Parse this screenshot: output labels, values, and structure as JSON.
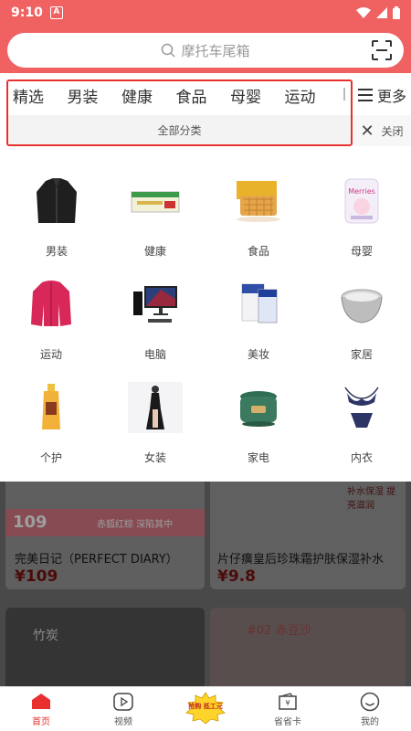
{
  "status_bar": {
    "time": "9:10",
    "notif_letter": "A"
  },
  "search": {
    "placeholder": "摩托车尾箱"
  },
  "tabs": [
    "精选",
    "男装",
    "健康",
    "食品",
    "母婴",
    "运动"
  ],
  "more_label": "更多",
  "all_categories_label": "全部分类",
  "close_label": "关闭",
  "categories": [
    {
      "label": "男装",
      "icon": "jacket-icon"
    },
    {
      "label": "健康",
      "icon": "medicine-box-icon"
    },
    {
      "label": "食品",
      "icon": "waffle-icon"
    },
    {
      "label": "母婴",
      "icon": "diaper-pack-icon"
    },
    {
      "label": "运动",
      "icon": "sport-jacket-icon"
    },
    {
      "label": "电脑",
      "icon": "desktop-computer-icon"
    },
    {
      "label": "美妆",
      "icon": "skincare-box-icon"
    },
    {
      "label": "家居",
      "icon": "steel-bowl-icon"
    },
    {
      "label": "个护",
      "icon": "shampoo-bottle-icon"
    },
    {
      "label": "女装",
      "icon": "dress-icon"
    },
    {
      "label": "家电",
      "icon": "rice-cooker-icon"
    },
    {
      "label": "内衣",
      "icon": "lingerie-icon"
    }
  ],
  "products": [
    {
      "title": "完美日记（PERFECT DIARY）",
      "price": "¥109",
      "badge_price": "109",
      "banner_text": "赤狐红棕 深陷其中"
    },
    {
      "title": "片仔癀皇后珍珠霜护肤保湿补水",
      "price": "¥9.8",
      "banner_text": "补水保湿 提亮滋润"
    }
  ],
  "lower_cards": [
    {
      "overlay_text": "竹炭"
    },
    {
      "overlay_text": "#02 赤豆沙"
    }
  ],
  "bottom_nav": [
    {
      "label": "首页",
      "icon": "home-icon",
      "active": true
    },
    {
      "label": "视频",
      "icon": "video-play-icon"
    },
    {
      "label": "",
      "icon": "promo-badge-icon",
      "promo_text": "抢购 抵工元"
    },
    {
      "label": "省省卡",
      "icon": "wallet-card-icon"
    },
    {
      "label": "我的",
      "icon": "smiley-profile-icon"
    }
  ],
  "colors": {
    "brand": "#f06262",
    "accent": "#e8312e",
    "price": "#e8312e"
  }
}
